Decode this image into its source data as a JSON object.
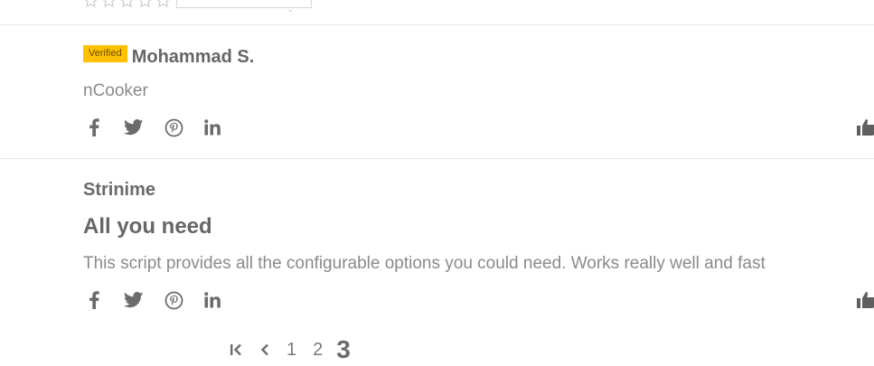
{
  "reviews": [
    {
      "badge": "Verified",
      "author": "Mohammad S.",
      "body": "nCooker"
    },
    {
      "author": "Strinime",
      "title": "All you need",
      "body": "This script provides all the configurable options you could need. Works really well and fast"
    }
  ],
  "social_icons": [
    "facebook-icon",
    "twitter-icon",
    "pinterest-icon",
    "linkedin-icon"
  ],
  "pagination": {
    "pages": [
      "1",
      "2",
      "3"
    ],
    "current": "3"
  },
  "colors": {
    "badge": "#ffc000",
    "text": "#6b6b6b",
    "divider": "#e9e9e9"
  }
}
